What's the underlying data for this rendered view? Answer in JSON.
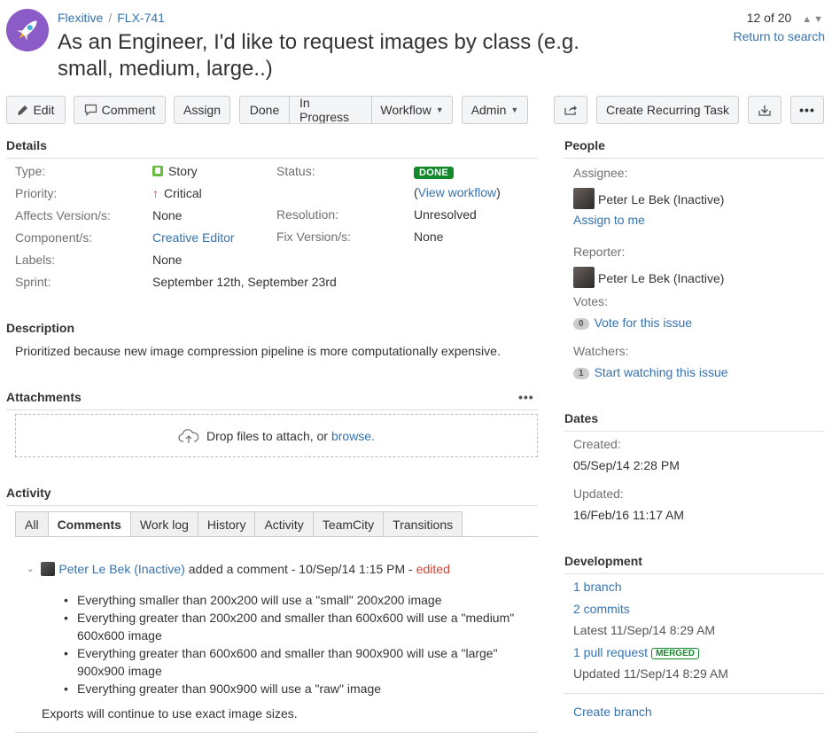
{
  "header": {
    "project": "Flexitive",
    "separator": "/",
    "issue_key": "FLX-741",
    "title": "As an Engineer, I'd like to request images by class (e.g. small, medium, large..)",
    "pager": "12 of 20",
    "return_to_search": "Return to search"
  },
  "toolbar": {
    "edit": "Edit",
    "comment": "Comment",
    "assign": "Assign",
    "done": "Done",
    "in_progress": "In Progress",
    "workflow": "Workflow",
    "admin": "Admin",
    "create_recurring": "Create Recurring Task"
  },
  "details": {
    "heading": "Details",
    "type_label": "Type:",
    "type_value": "Story",
    "priority_label": "Priority:",
    "priority_value": "Critical",
    "affects_label": "Affects Version/s:",
    "affects_value": "None",
    "component_label": "Component/s:",
    "component_value": "Creative Editor",
    "labels_label": "Labels:",
    "labels_value": "None",
    "sprint_label": "Sprint:",
    "sprint_value": "September 12th, September 23rd",
    "status_label": "Status:",
    "status_value": "DONE",
    "view_workflow_open": "(",
    "view_workflow": "View workflow",
    "view_workflow_close": ")",
    "resolution_label": "Resolution:",
    "resolution_value": "Unresolved",
    "fix_label": "Fix Version/s:",
    "fix_value": "None"
  },
  "description": {
    "heading": "Description",
    "text": "Prioritized because new image compression pipeline is more computationally expensive."
  },
  "attachments": {
    "heading": "Attachments",
    "drop_text": "Drop files to attach, or",
    "browse": "browse."
  },
  "activity": {
    "heading": "Activity",
    "tabs": [
      "All",
      "Comments",
      "Work log",
      "History",
      "Activity",
      "TeamCity",
      "Transitions"
    ],
    "comment": {
      "author": "Peter Le Bek (Inactive)",
      "action": "added a comment - 10/Sep/14 1:15 PM -",
      "edited": "edited",
      "items": [
        "Everything smaller than 200x200 will use a \"small\" 200x200 image",
        "Everything greater than 200x200 and smaller than 600x600 will use a \"medium\" 600x600 image",
        "Everything greater than 600x600 and smaller than 900x900 will use a \"large\" 900x900 image",
        "Everything greater than 900x900 will use a \"raw\" image"
      ],
      "footer": "Exports will continue to use exact image sizes."
    }
  },
  "people": {
    "heading": "People",
    "assignee_label": "Assignee:",
    "assignee": "Peter Le Bek (Inactive)",
    "assign_to_me": "Assign to me",
    "reporter_label": "Reporter:",
    "reporter": "Peter Le Bek (Inactive)",
    "votes_label": "Votes:",
    "votes_count": "0",
    "vote_link": "Vote for this issue",
    "watchers_label": "Watchers:",
    "watchers_count": "1",
    "watch_link": "Start watching this issue"
  },
  "dates": {
    "heading": "Dates",
    "created_label": "Created:",
    "created": "05/Sep/14 2:28 PM",
    "updated_label": "Updated:",
    "updated": "16/Feb/16 11:17 AM"
  },
  "development": {
    "heading": "Development",
    "branch": "1 branch",
    "commits": "2 commits",
    "latest": "Latest 11/Sep/14 8:29 AM",
    "pull_request": "1 pull request",
    "merged": "MERGED",
    "pr_updated": "Updated 11/Sep/14 8:29 AM",
    "create_branch": "Create branch"
  },
  "colors": {
    "link": "#3572b0",
    "done": "#14892c",
    "critical": "#d04437",
    "avatar": "#8b5cc8"
  }
}
